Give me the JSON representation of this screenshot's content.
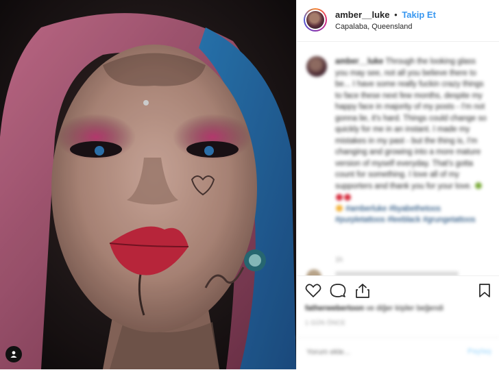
{
  "post": {
    "header": {
      "username": "amber__luke",
      "separator": "•",
      "follow_label": "Takip Et",
      "location": "Capalaba, Queensland",
      "more_icon": "more-options-icon"
    },
    "caption": {
      "username": "amber__luke",
      "text": "Through the looking glass you may see, not all you believe there to be... I have some really fuckin crazy things to face these next few months, despite my happy face in majority of my posts - I'm not gonna lie, it's hard. Things could change so quickly for me in an instant. I made my mistakes in my past - but the thing is, I'm changing and growing into a more mature version of myself everyday. That's gotta count for something. I love all of my supporters and thank you for your love.",
      "hashtags": "#amberluke #byabethetoos #purpletattoos #leeblack #grungetattoos",
      "time": "1h",
      "emoji_colors": [
        "#7dac3e",
        "#d62f3f",
        "#d62f3f",
        "#f3b33d"
      ]
    },
    "actions": {
      "like_icon": "heart-icon",
      "comment_icon": "comment-icon",
      "share_icon": "share-icon",
      "save_icon": "bookmark-icon"
    },
    "likes": {
      "text": "fatherwebertoon ve diğer kişiler beğendi",
      "first_user": "fatherwebertoon",
      "rest": "ve diğer kişiler beğendi"
    },
    "date": "1 GÜN ÖNCE",
    "comment_placeholder": "Yorum ekle...",
    "post_button": "Paylaş",
    "user_tag_icon": "user-tag-icon"
  },
  "colors": {
    "link": "#3897f0",
    "hashtag": "#003569",
    "border": "#efefef"
  }
}
